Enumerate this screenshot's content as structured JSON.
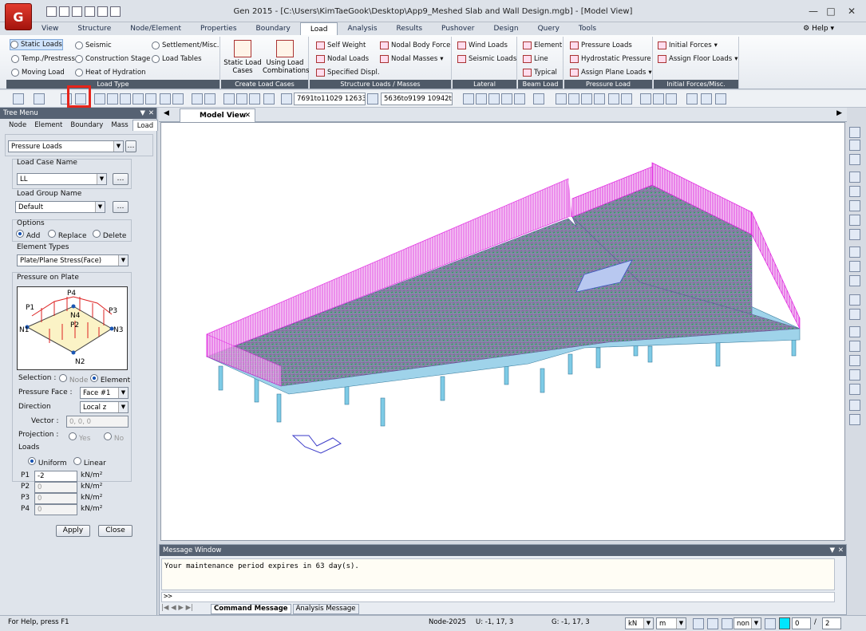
{
  "app": {
    "title": "Gen 2015 - [C:\\Users\\KimTaeGook\\Desktop\\App9_Meshed Slab and Wall Design.mgb] - [Model View]",
    "help": "Help"
  },
  "menu": {
    "tabs": [
      "View",
      "Structure",
      "Node/Element",
      "Properties",
      "Boundary",
      "Load",
      "Analysis",
      "Results",
      "Pushover",
      "Design",
      "Query",
      "Tools"
    ],
    "active": "Load"
  },
  "ribbon": {
    "load_type": {
      "title": "Load Type",
      "items": [
        "Static Loads",
        "Seismic",
        "Settlement/Misc.",
        "Temp./Prestress",
        "Construction Stage",
        "Load Tables",
        "Moving Load",
        "Heat of Hydration"
      ]
    },
    "create_load_cases": {
      "title": "Create Load Cases",
      "static": "Static Load",
      "static2": "Cases",
      "combo": "Using Load",
      "combo2": "Combinations"
    },
    "structure_loads": {
      "title": "Structure Loads / Masses",
      "items": [
        "Self Weight",
        "Nodal Body Force",
        "Nodal Loads",
        "Nodal Masses",
        "Specified Displ."
      ]
    },
    "lateral": {
      "title": "Lateral",
      "items": [
        "Wind Loads",
        "Seismic Loads"
      ]
    },
    "beam_load": {
      "title": "Beam Load",
      "items": [
        "Element",
        "Line",
        "Typical"
      ]
    },
    "pressure_load": {
      "title": "Pressure Load",
      "items": [
        "Pressure Loads",
        "Hydrostatic Pressure",
        "Assign Plane Loads"
      ]
    },
    "initial_forces": {
      "title": "Initial Forces/Misc.",
      "items": [
        "Initial Forces",
        "Assign Floor Loads"
      ]
    }
  },
  "toolbar": {
    "node_select": "7691to11029 12633",
    "elem_select": "5636to9199 10942t"
  },
  "tree": {
    "title": "Tree Menu",
    "tabs": [
      "Node",
      "Element",
      "Boundary",
      "Mass",
      "Load"
    ],
    "active_tab": "Load",
    "load_type": "Pressure Loads",
    "load_case_label": "Load Case Name",
    "load_case": "LL",
    "load_group_label": "Load Group Name",
    "load_group": "Default",
    "options_label": "Options",
    "options": [
      "Add",
      "Replace",
      "Delete"
    ],
    "element_types_label": "Element Types",
    "element_type": "Plate/Plane Stress(Face)",
    "pressure_on_plate": "Pressure on Plate",
    "selection_label": "Selection :",
    "selection_node": "Node",
    "selection_element": "Element",
    "pressure_face_label": "Pressure Face :",
    "pressure_face": "Face #1",
    "direction_label": "Direction",
    "direction": "Local z",
    "vector_label": "Vector :",
    "vector": "0, 0, 0",
    "projection_label": "Projection :",
    "proj_yes": "Yes",
    "proj_no": "No",
    "loads_label": "Loads",
    "uniform": "Uniform",
    "linear": "Linear",
    "p_labels": [
      "P1",
      "P2",
      "P3",
      "P4"
    ],
    "p_values": [
      "-2",
      "0",
      "0",
      "0"
    ],
    "unit": "kN/m²",
    "apply": "Apply",
    "close": "Close",
    "diagram": {
      "p1": "P1",
      "p2": "P2",
      "p3": "P3",
      "p4": "P4",
      "n1": "N1",
      "n2": "N2",
      "n3": "N3",
      "n4": "N4"
    }
  },
  "view": {
    "tab": "Model View"
  },
  "message": {
    "title": "Message Window",
    "text": "Your maintenance period expires in 63 day(s).",
    "prompt": ">>",
    "tabs": [
      "Command Message",
      "Analysis Message"
    ]
  },
  "status": {
    "help": "For Help, press F1",
    "node": "Node-2025",
    "u": "U: -1, 17, 3",
    "g": "G: -1, 17, 3",
    "force_unit": "kN",
    "length_unit": "m",
    "mode": "non",
    "page": "0",
    "page_total": "2"
  },
  "colors": {
    "accent": "#e6241b",
    "mesh": "#e020e0",
    "pressure": "#2e9b5a",
    "column": "#7ecbe6"
  }
}
